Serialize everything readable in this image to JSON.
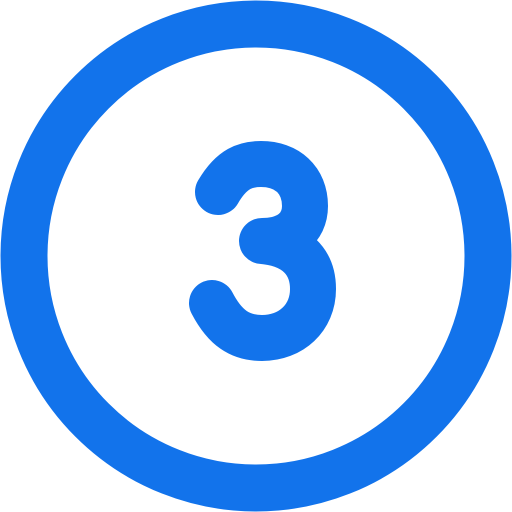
{
  "icon": {
    "name": "number-3-circle-icon",
    "number": "3",
    "color": "#1273EB",
    "background": "#FFFFFF"
  }
}
